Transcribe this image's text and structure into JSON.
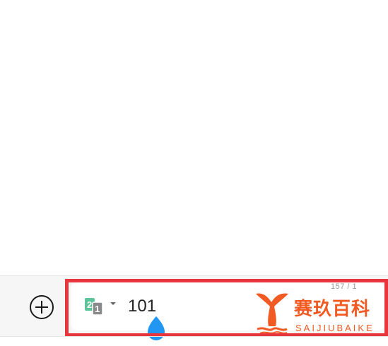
{
  "input": {
    "value": "101",
    "char_counter": "157 / 1"
  },
  "sim_icon": {
    "front_label": "1",
    "back_label": "2"
  },
  "watermark": {
    "title": "赛玖百科",
    "subtitle": "SAIJIUBAIKE"
  },
  "colors": {
    "highlight_border": "#e8363c",
    "sim_green": "#5cc39a",
    "sim_gray": "#8a8a8a",
    "cursor_blue": "#2196f3",
    "watermark_orange": "#f15a22"
  }
}
